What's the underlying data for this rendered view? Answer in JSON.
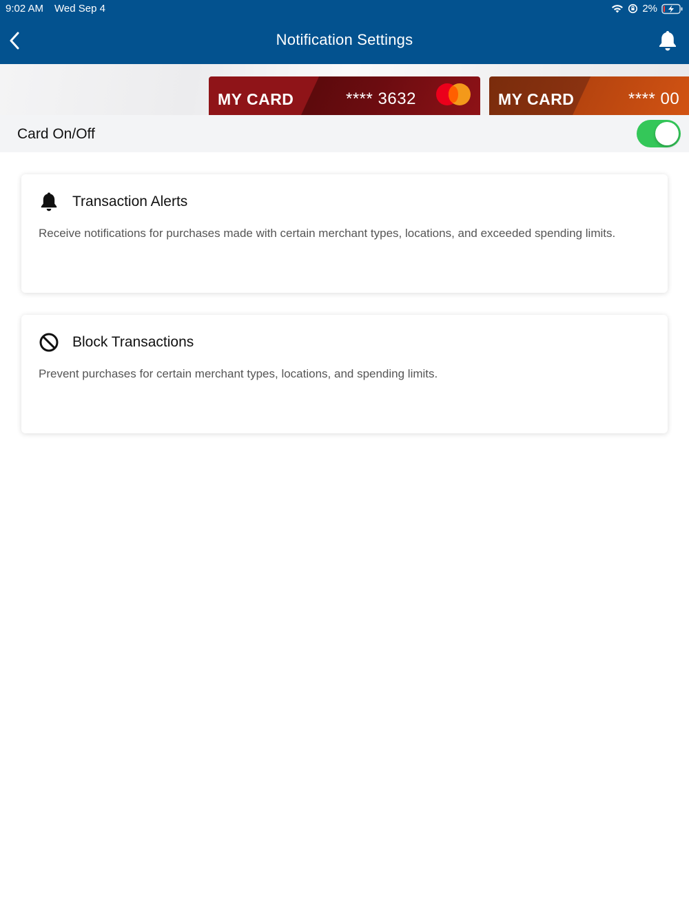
{
  "status_bar": {
    "time": "9:02 AM",
    "date": "Wed Sep 4",
    "battery": "2%"
  },
  "header": {
    "title": "Notification Settings",
    "background_color": "#03528f"
  },
  "cards": [
    {
      "name": "MY CARD",
      "number": "**** 3632",
      "brand_icon": "mastercard-logo"
    },
    {
      "name": "MY CARD",
      "number": "**** 00"
    }
  ],
  "card_toggle": {
    "label": "Card On/Off",
    "state": "on",
    "color": "#34c759"
  },
  "panels": {
    "alerts": {
      "icon": "bell-icon",
      "title": "Transaction Alerts",
      "description": "Receive notifications for purchases made with certain merchant types, locations, and exceeded spending limits."
    },
    "block": {
      "icon": "block-icon",
      "title": "Block Transactions",
      "description": "Prevent purchases for certain merchant types, locations, and spending limits."
    }
  }
}
